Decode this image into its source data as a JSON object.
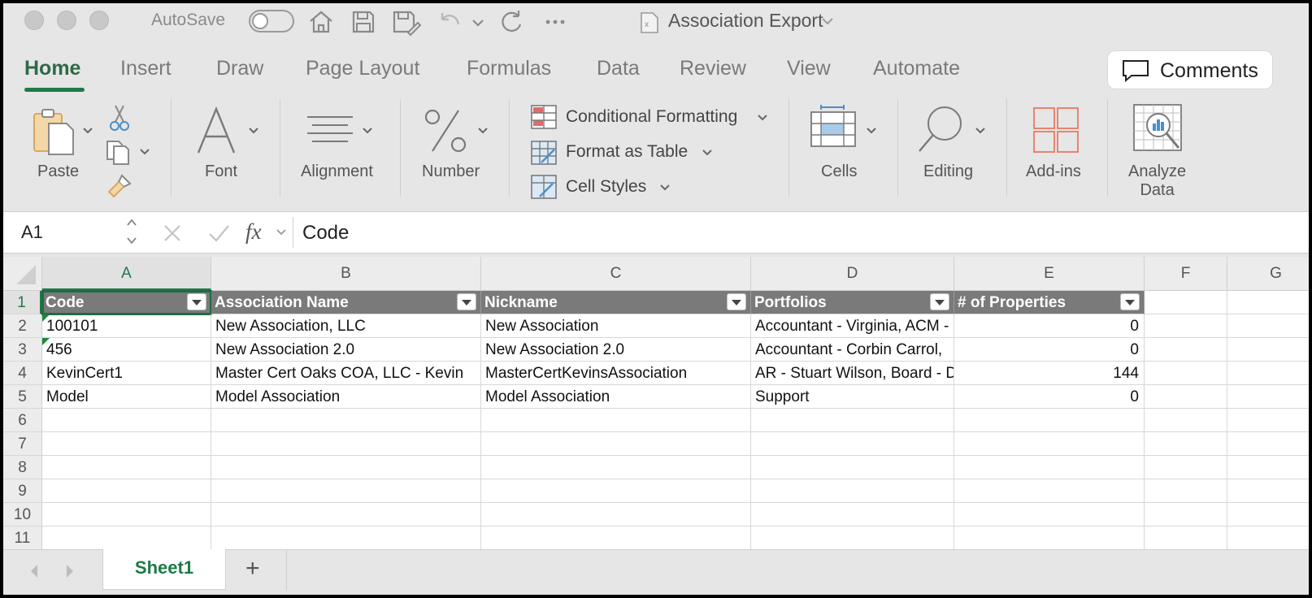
{
  "titlebar": {
    "autosave_label": "AutoSave",
    "autosave_on": false,
    "document_title": "Association Export"
  },
  "ribbon_tabs": [
    "Home",
    "Insert",
    "Draw",
    "Page Layout",
    "Formulas",
    "Data",
    "Review",
    "View",
    "Automate"
  ],
  "active_tab": "Home",
  "comments_label": "Comments",
  "ribbon": {
    "paste": "Paste",
    "font": "Font",
    "alignment": "Alignment",
    "number": "Number",
    "conditional_formatting": "Conditional Formatting",
    "format_as_table": "Format as Table",
    "cell_styles": "Cell Styles",
    "cells": "Cells",
    "editing": "Editing",
    "addins": "Add-ins",
    "analyze_line1": "Analyze",
    "analyze_line2": "Data"
  },
  "formula_bar": {
    "name_box": "A1",
    "fx_label": "fx",
    "value": "Code"
  },
  "columns": [
    "A",
    "B",
    "C",
    "D",
    "E",
    "F",
    "G"
  ],
  "rows": [
    "1",
    "2",
    "3",
    "4",
    "5",
    "6",
    "7",
    "8",
    "9",
    "10",
    "11"
  ],
  "table": {
    "headers": [
      "Code",
      "Association Name",
      "Nickname",
      "Portfolios",
      "# of Properties"
    ],
    "rows": [
      [
        "100101",
        "New Association, LLC",
        "New Association",
        "Accountant - Virginia, ACM - ",
        "0"
      ],
      [
        "456",
        "New Association 2.0",
        "New Association 2.0",
        "Accountant - Corbin Carrol, ",
        "0"
      ],
      [
        "KevinCert1",
        "Master Cert Oaks COA, LLC - Kevin",
        "MasterCertKevinsAssociation",
        "AR - Stuart Wilson, Board - D",
        "144"
      ],
      [
        "Model",
        "Model Association",
        "Model Association",
        "Support",
        "0"
      ]
    ]
  },
  "sheets": [
    "Sheet1"
  ],
  "add_sheet_label": "+",
  "colors": {
    "accent": "#1f7a47",
    "header_fill": "#7a7a7a",
    "addins_icon": "#e8836f"
  }
}
